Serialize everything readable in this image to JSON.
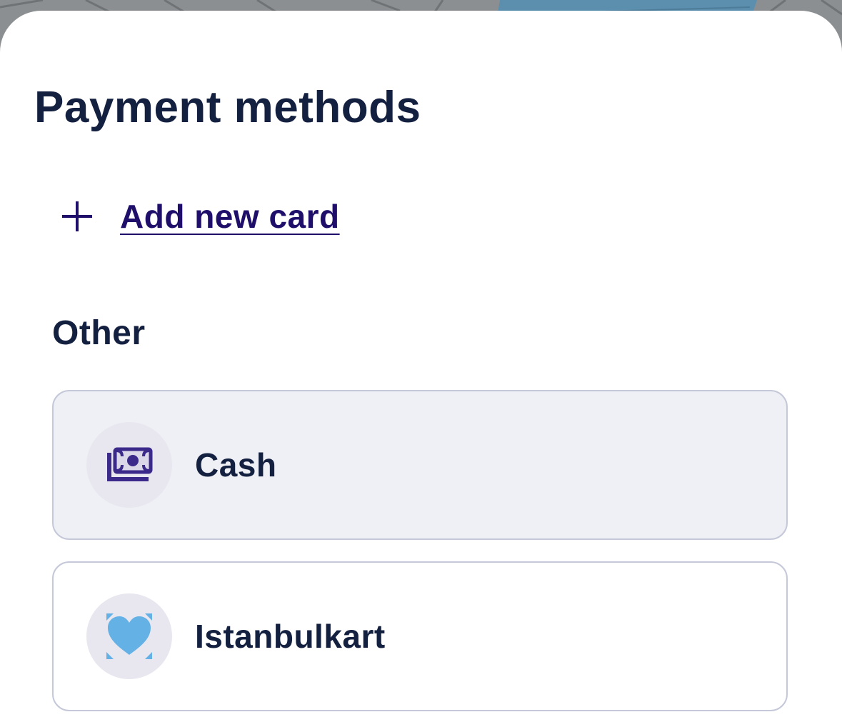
{
  "sheet": {
    "title": "Payment methods"
  },
  "add_card": {
    "label": "Add new card",
    "icon": "plus-icon"
  },
  "other_section": {
    "heading": "Other",
    "options": [
      {
        "label": "Cash",
        "icon": "cash-icon",
        "selected": true
      },
      {
        "label": "Istanbulkart",
        "icon": "istanbulkart-icon",
        "selected": false
      }
    ]
  },
  "colors": {
    "title_text": "#142040",
    "link_accent": "#1f0f6b",
    "selected_background": "#eff0f5",
    "option_border": "#c5c8d8",
    "icon_circle": "#e8e7f0",
    "cash_icon": "#3b2a8a",
    "istanbulkart_icon": "#63b1e5"
  }
}
